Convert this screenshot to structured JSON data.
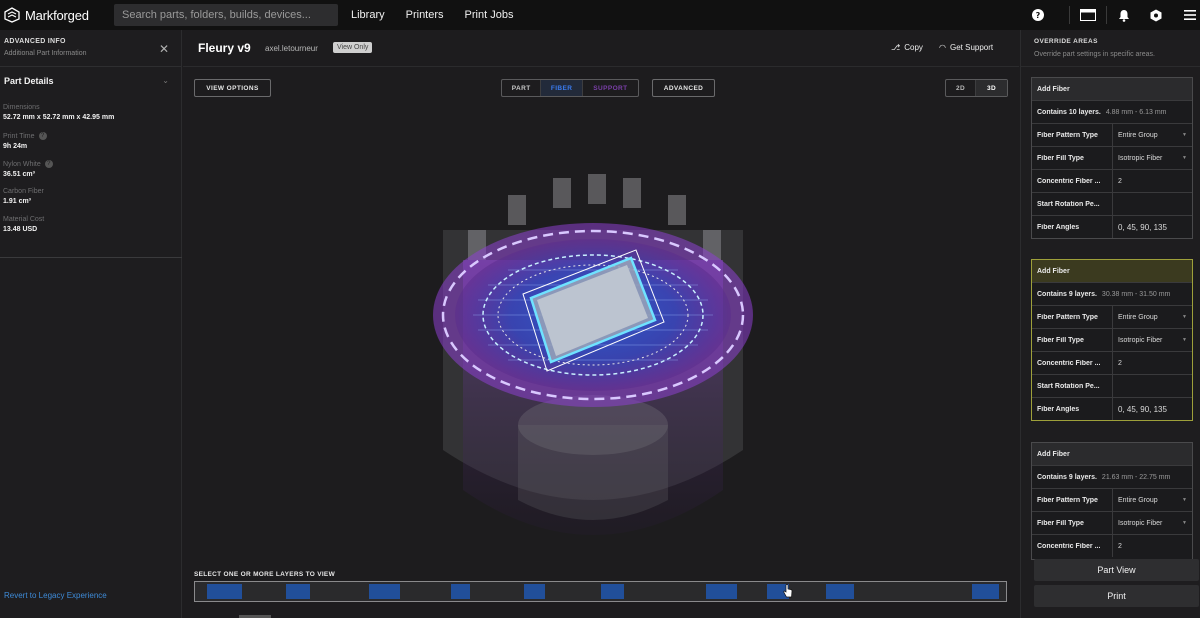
{
  "topbar": {
    "brand": "Markforged",
    "search_placeholder": "Search parts, folders, builds, devices...",
    "nav": [
      "Library",
      "Printers",
      "Print Jobs"
    ],
    "icons": [
      "help-icon",
      "window-icon",
      "bell-icon",
      "settings-hex-icon",
      "menu-icon"
    ]
  },
  "left": {
    "title": "ADVANCED INFO",
    "subtitle": "Additional Part Information",
    "section": "Part Details",
    "details": [
      {
        "label": "Dimensions",
        "value": "52.72 mm x 52.72 mm x 42.95 mm",
        "help": false
      },
      {
        "label": "Print Time",
        "value": "9h 24m",
        "help": true
      },
      {
        "label": "Nylon White",
        "value": "36.51 cm³",
        "help": true
      },
      {
        "label": "Carbon Fiber",
        "value": "1.91 cm³",
        "help": false
      },
      {
        "label": "Material Cost",
        "value": "13.48 USD",
        "help": false
      }
    ],
    "revert": "Revert to Legacy Experience"
  },
  "center": {
    "part_name": "Fleury v9",
    "owner": "axel.letourneur",
    "badge": "View Only",
    "copy": "Copy",
    "support": "Get Support",
    "view_options": "VIEW OPTIONS",
    "modes": [
      "PART",
      "FIBER",
      "SUPPORT"
    ],
    "advanced": "ADVANCED",
    "dims": [
      "2D",
      "3D"
    ],
    "layers_label": "SELECT ONE OR MORE LAYERS TO VIEW",
    "accent_fiber": "#3a7bf0",
    "accent_support": "#7a3fa8"
  },
  "right": {
    "title": "OVERRIDE AREAS",
    "subtitle": "Override part settings in specific areas.",
    "cards": [
      {
        "head": "Add Fiber",
        "contains": "Contains 10 layers.",
        "range": "4.88 mm - 6.13 mm",
        "rows": [
          {
            "k": "Fiber Pattern Type",
            "v": "Entire Group",
            "dropdown": true
          },
          {
            "k": "Fiber Fill Type",
            "v": "Isotropic Fiber",
            "dropdown": true
          },
          {
            "k": "Concentric Fiber ...",
            "v": "2",
            "dropdown": false
          },
          {
            "k": "Start Rotation Pe...",
            "v": "",
            "dropdown": false
          },
          {
            "k": "Fiber Angles",
            "v": "0, 45, 90, 135",
            "dropdown": false
          }
        ]
      },
      {
        "head": "Add Fiber",
        "contains": "Contains 9 layers.",
        "range": "30.38 mm - 31.50 mm",
        "rows": [
          {
            "k": "Fiber Pattern Type",
            "v": "Entire Group",
            "dropdown": true
          },
          {
            "k": "Fiber Fill Type",
            "v": "Isotropic Fiber",
            "dropdown": true
          },
          {
            "k": "Concentric Fiber ...",
            "v": "2",
            "dropdown": false
          },
          {
            "k": "Start Rotation Pe...",
            "v": "",
            "dropdown": false
          },
          {
            "k": "Fiber Angles",
            "v": "0, 45, 90, 135",
            "dropdown": false
          }
        ]
      },
      {
        "head": "Add Fiber",
        "contains": "Contains 9 layers.",
        "range": "21.63 mm - 22.75 mm",
        "rows": [
          {
            "k": "Fiber Pattern Type",
            "v": "Entire Group",
            "dropdown": true
          },
          {
            "k": "Fiber Fill Type",
            "v": "Isotropic Fiber",
            "dropdown": true
          },
          {
            "k": "Concentric Fiber ...",
            "v": "2",
            "dropdown": false
          }
        ]
      }
    ],
    "part_view": "Part View",
    "print": "Print"
  }
}
